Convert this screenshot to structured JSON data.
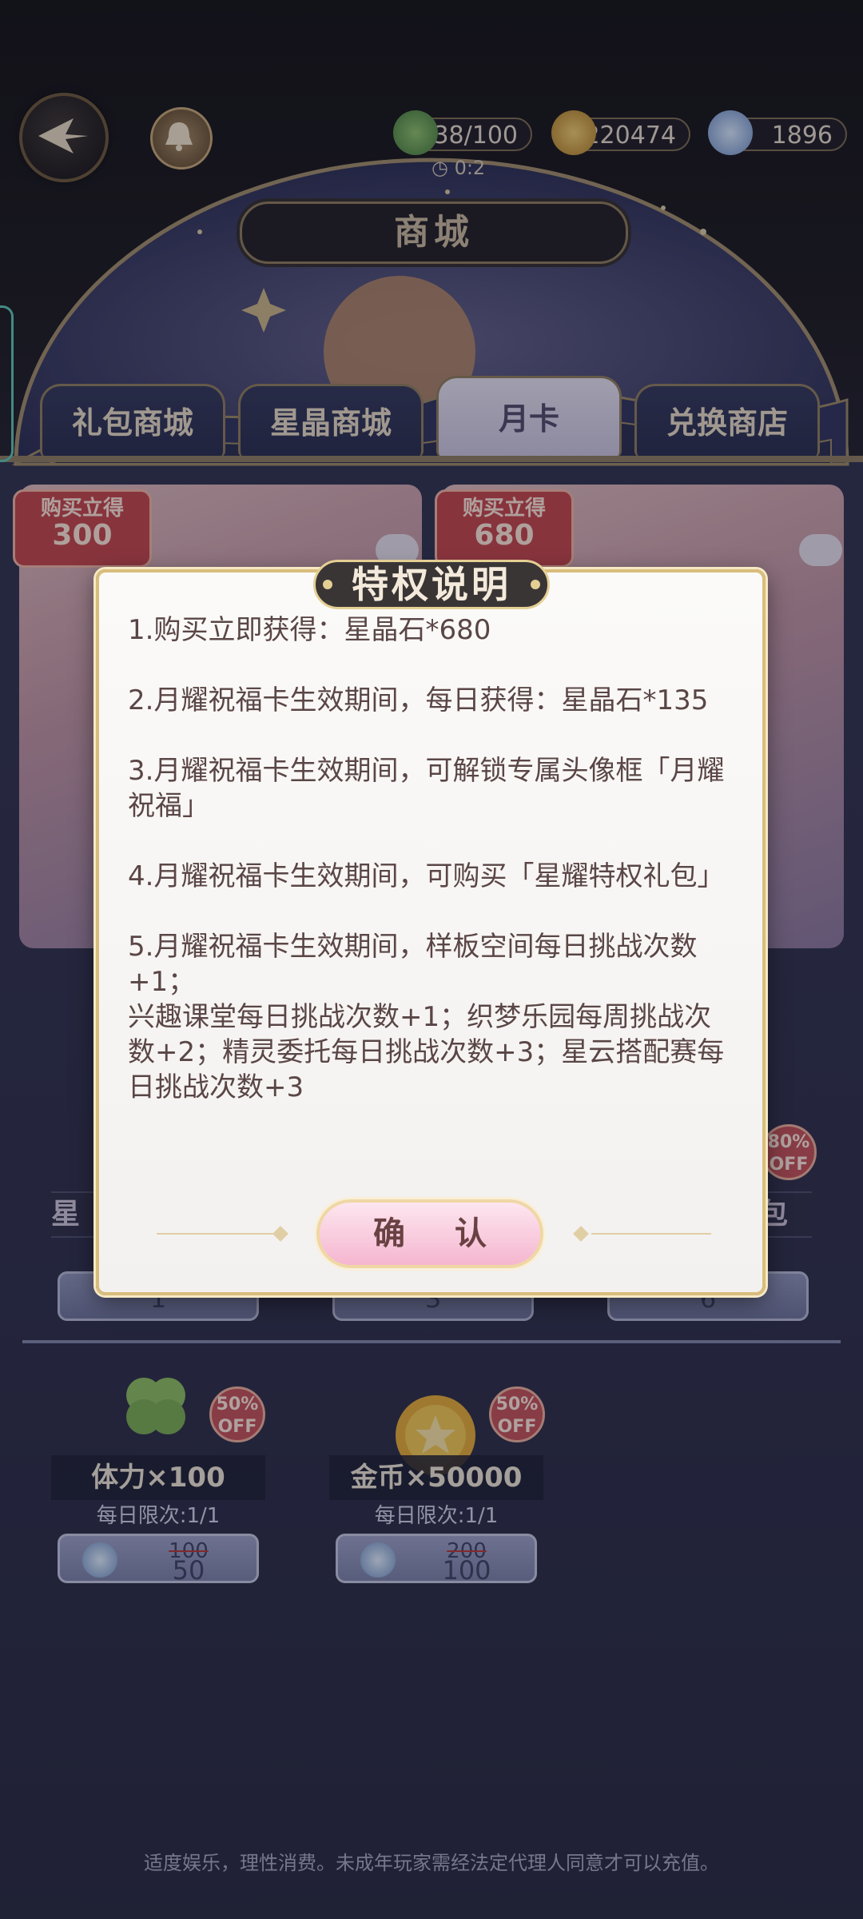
{
  "header": {
    "currencies": [
      {
        "icon": "clover-icon",
        "value": "38/100"
      },
      {
        "icon": "gold-coin-icon",
        "value": "220474"
      },
      {
        "icon": "star-crystal-icon",
        "value": "1896"
      }
    ],
    "timer": "0:2",
    "title": "商城"
  },
  "tabs": [
    {
      "label": "礼包商城"
    },
    {
      "label": "星晶商城"
    },
    {
      "label": "月卡",
      "active": true
    },
    {
      "label": "兑换商店"
    }
  ],
  "cards": [
    {
      "badge_label": "购买立得",
      "badge_value": "300"
    },
    {
      "badge_label": "购买立得",
      "badge_value": "680"
    }
  ],
  "background_row": {
    "left_fragment": "星",
    "right_fragment": "包",
    "off_badge": "80% OFF",
    "values": [
      "1",
      "3",
      "6"
    ]
  },
  "items": [
    {
      "title": "体力×100",
      "limit": "每日限次:1/1",
      "old_price": "100",
      "new_price": "50",
      "off": "50% OFF"
    },
    {
      "title": "金币×50000",
      "limit": "每日限次:1/1",
      "old_price": "200",
      "new_price": "100",
      "off": "50% OFF"
    }
  ],
  "dialog": {
    "title": "特权说明",
    "lines": [
      "1.购买立即获得：星晶石*680",
      "2.月耀祝福卡生效期间，每日获得：星晶石*135",
      "3.月耀祝福卡生效期间，可解锁专属头像框「月耀祝福」",
      "4.月耀祝福卡生效期间，可购买「星耀特权礼包」",
      "5.月耀祝福卡生效期间，样板空间每日挑战次数+1；",
      "兴趣课堂每日挑战次数+1；织梦乐园每周挑战次数+2；精灵委托每日挑战次数+3；星云搭配赛每日挑战次数+3"
    ],
    "confirm_label": "确 认"
  },
  "footer": "适度娱乐，理性消费。未成年玩家需经法定代理人同意才可以充值。",
  "colors": {
    "accent_gold": "#d9bd7c",
    "dialog_text": "#5a4646",
    "confirm_pink": "#f5b6cf",
    "badge_red": "#c44348"
  }
}
